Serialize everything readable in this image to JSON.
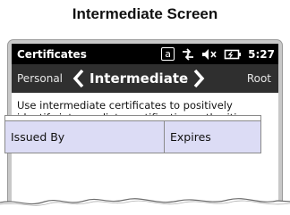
{
  "caption": "Intermediate Screen",
  "statusbar": {
    "title": "Certificates",
    "keyboard_icon": "a",
    "icons": [
      "keyboard-icon",
      "signal-icon",
      "volume-muted-icon",
      "battery-icon"
    ],
    "time": "5:27"
  },
  "nav": {
    "prev": "Personal",
    "current": "Intermediate",
    "next": "Root"
  },
  "description": "Use intermediate certificates to positively identify intermediate certification authorities.",
  "table": {
    "columns": [
      "Issued By",
      "Expires"
    ]
  },
  "colors": {
    "statusbar_bg": "#000000",
    "navbar_bg": "#2f2f2f",
    "header_bg": "#dcdcf5"
  }
}
